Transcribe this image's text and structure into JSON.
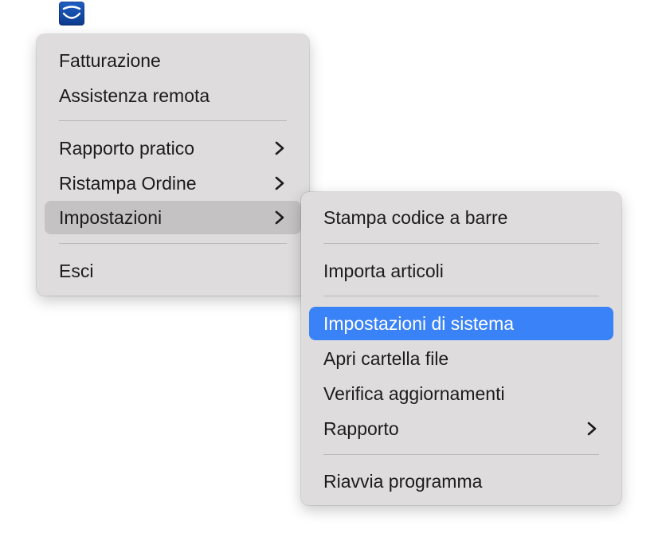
{
  "main_menu": {
    "items": [
      {
        "label": "Fatturazione"
      },
      {
        "label": "Assistenza remota"
      },
      {
        "label": "Rapporto pratico"
      },
      {
        "label": "Ristampa Ordine"
      },
      {
        "label": "Impostazioni"
      },
      {
        "label": "Esci"
      }
    ]
  },
  "sub_menu": {
    "items": [
      {
        "label": "Stampa codice a barre"
      },
      {
        "label": "Importa articoli"
      },
      {
        "label": "Impostazioni di sistema"
      },
      {
        "label": "Apri cartella file"
      },
      {
        "label": "Verifica aggiornamenti"
      },
      {
        "label": "Rapporto"
      },
      {
        "label": "Riavvia programma"
      }
    ]
  },
  "state": {
    "hovered_main_item": "Impostazioni",
    "selected_sub_item": "Impostazioni di sistema"
  },
  "colors": {
    "menu_background": "#dedcdd",
    "hover_background": "#c4c2c3",
    "selection_accent": "#3a82f7"
  }
}
